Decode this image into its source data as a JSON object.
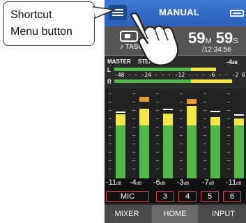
{
  "callout": {
    "line1": "Shortcut",
    "line2": "Menu button"
  },
  "header": {
    "title": "MANUAL",
    "menu_icon": "menu-icon",
    "battery_icon": "battery-icon"
  },
  "recorder": {
    "device_name": "♪ TASC",
    "minutes": "59",
    "minutes_unit": "M",
    "seconds": "59",
    "seconds_unit": "S",
    "total_time": "/12:34:56"
  },
  "master": {
    "label": "MASTER",
    "stereo": "STEREO",
    "level": "-4",
    "level_unit": "dB",
    "left": "L",
    "right": "R",
    "scale": "-48 · · -24 · · · -12 · · · -6 · · -2 0",
    "left_level": 0.82,
    "right_level": 0.95
  },
  "channels": [
    {
      "value": "-11",
      "unit": "dB",
      "level": 0.75,
      "peak": 0.77
    },
    {
      "value": "-4",
      "unit": "dB",
      "level": 0.82,
      "peak": 0.9
    },
    {
      "value": "-6",
      "unit": "dB",
      "level": 0.76,
      "peak": 0.8
    },
    {
      "value": "-3",
      "unit": "dB",
      "level": 0.85,
      "peak": 0.88
    },
    {
      "value": "-7",
      "unit": "dB",
      "level": 0.72,
      "peak": 0.78
    },
    {
      "value": "-11",
      "unit": "dB",
      "level": 0.7,
      "peak": 0.74
    }
  ],
  "inputs": [
    "MIC",
    "3",
    "4",
    "5",
    "6"
  ],
  "tabs": [
    "MIXER",
    "HOME",
    "INPUT"
  ],
  "active_tab": "HOME",
  "colors": {
    "header": "#2b5fb8",
    "meter_green": "#54b849",
    "meter_yellow": "#f1e64a",
    "input_border": "#e04343"
  }
}
